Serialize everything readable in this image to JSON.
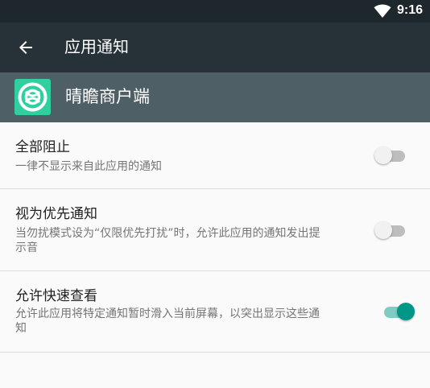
{
  "status_bar": {
    "time": "9:16"
  },
  "toolbar": {
    "back_icon": "arrow-back-icon",
    "title": "应用通知"
  },
  "app": {
    "icon": "app-logo-icon",
    "name": "晴瞻商户端",
    "icon_color": "#2fcf9f"
  },
  "settings": [
    {
      "title": "全部阻止",
      "subtitle": "一律不显示来自此应用的通知",
      "enabled": false
    },
    {
      "title": "视为优先通知",
      "subtitle_line1": "当勿扰模式设为“仅限优先打扰”时，允许此应用的通知发出提",
      "subtitle_line2": "示音",
      "enabled": false
    },
    {
      "title": "允许快速查看",
      "subtitle_line1": "允许此应用将特定通知暂时滑入当前屏幕，以突出显示这些通",
      "subtitle_line2": "知",
      "enabled": true
    }
  ],
  "colors": {
    "status_bar": "#1e272c",
    "toolbar": "#263238",
    "app_header": "#4f5f66",
    "accent": "#009688"
  }
}
